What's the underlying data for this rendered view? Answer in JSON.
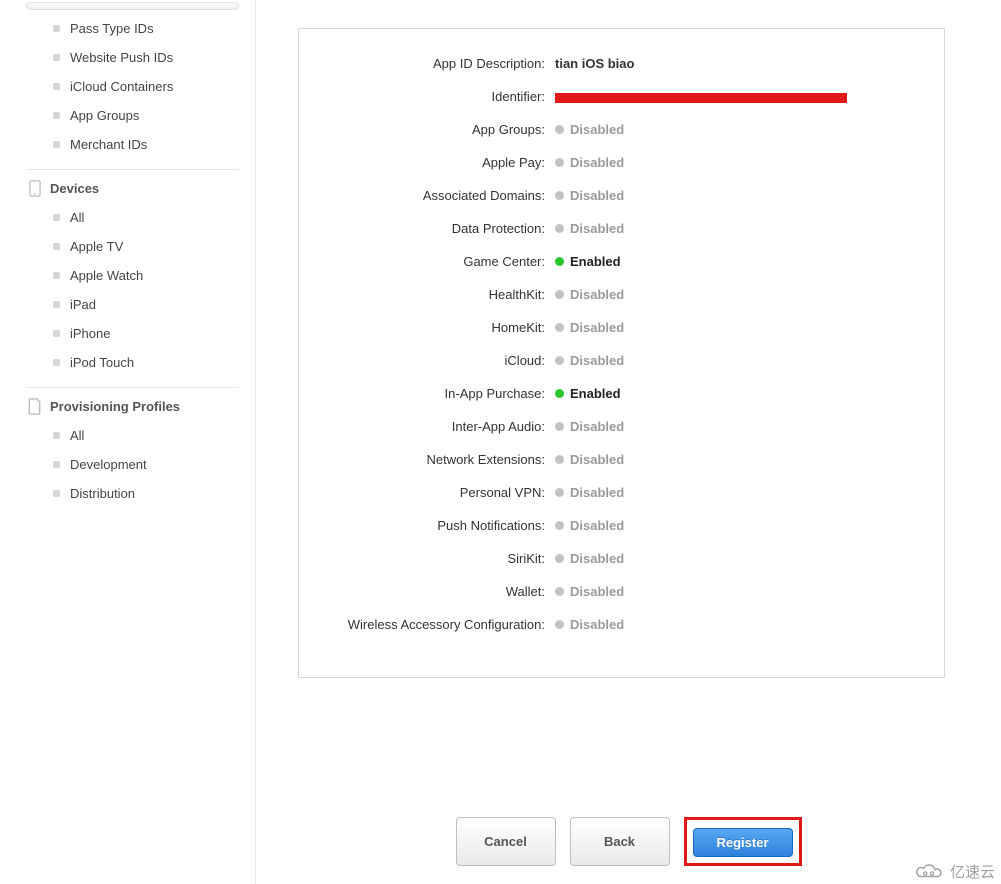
{
  "sidebar": {
    "group1": [
      "Pass Type IDs",
      "Website Push IDs",
      "iCloud Containers",
      "App Groups",
      "Merchant IDs"
    ],
    "devices_header": "Devices",
    "devices": [
      "All",
      "Apple TV",
      "Apple Watch",
      "iPad",
      "iPhone",
      "iPod Touch"
    ],
    "profiles_header": "Provisioning Profiles",
    "profiles": [
      "All",
      "Development",
      "Distribution"
    ]
  },
  "panel": {
    "description_label": "App ID Description:",
    "description_value": "tian iOS biao",
    "identifier_label": "Identifier:",
    "identifier_value": "[REDACTED]",
    "capabilities": [
      {
        "label": "App Groups:",
        "status": "Disabled"
      },
      {
        "label": "Apple Pay:",
        "status": "Disabled"
      },
      {
        "label": "Associated Domains:",
        "status": "Disabled"
      },
      {
        "label": "Data Protection:",
        "status": "Disabled"
      },
      {
        "label": "Game Center:",
        "status": "Enabled"
      },
      {
        "label": "HealthKit:",
        "status": "Disabled"
      },
      {
        "label": "HomeKit:",
        "status": "Disabled"
      },
      {
        "label": "iCloud:",
        "status": "Disabled"
      },
      {
        "label": "In-App Purchase:",
        "status": "Enabled"
      },
      {
        "label": "Inter-App Audio:",
        "status": "Disabled"
      },
      {
        "label": "Network Extensions:",
        "status": "Disabled"
      },
      {
        "label": "Personal VPN:",
        "status": "Disabled"
      },
      {
        "label": "Push Notifications:",
        "status": "Disabled"
      },
      {
        "label": "SiriKit:",
        "status": "Disabled"
      },
      {
        "label": "Wallet:",
        "status": "Disabled"
      },
      {
        "label": "Wireless Accessory Configuration:",
        "status": "Disabled"
      }
    ]
  },
  "buttons": {
    "cancel": "Cancel",
    "back": "Back",
    "register": "Register"
  },
  "watermark": "亿速云"
}
